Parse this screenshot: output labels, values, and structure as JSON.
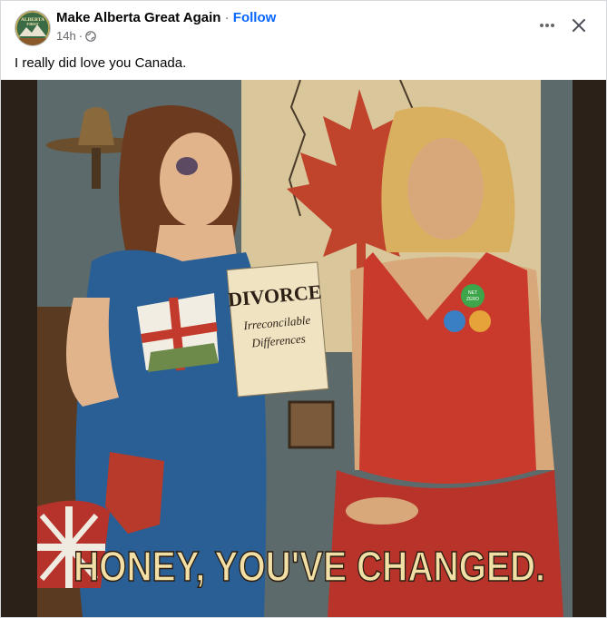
{
  "post": {
    "page_name": "Make Alberta Great Again",
    "separator": "·",
    "follow_label": "Follow",
    "time": "14h",
    "time_separator": "·",
    "audience_icon": "globe-icon",
    "caption": "I really did love you Canada.",
    "more_icon": "more-options-icon",
    "close_icon": "close-icon"
  },
  "avatar": {
    "text_line1": "ALBERTA",
    "text_line2": "FIRST"
  },
  "image": {
    "divorce_title": "DIVORCE",
    "divorce_line1": "Irreconcilable",
    "divorce_line2": "Differences",
    "headline": "HONEY, YOU'VE CHANGED.",
    "badge_text_line1": "NET",
    "badge_text_line2": "ZERO"
  },
  "colors": {
    "link": "#0866ff",
    "text_primary": "#050505",
    "text_secondary": "#65676b",
    "headline": "#f1dfa6"
  }
}
